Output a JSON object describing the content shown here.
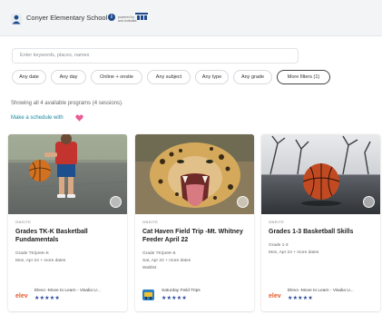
{
  "header": {
    "school_name": "Conyer Elementary School",
    "info_icon": "i",
    "powered_line1": "powered by",
    "powered_line2": "and durkdata"
  },
  "search": {
    "placeholder": "Enter keywords, places, names"
  },
  "filters": [
    {
      "label": "Any date",
      "active": false
    },
    {
      "label": "Any day",
      "active": false
    },
    {
      "label": "Online + onsite",
      "active": false
    },
    {
      "label": "Any subject",
      "active": false
    },
    {
      "label": "Any type",
      "active": false
    },
    {
      "label": "Any grade",
      "active": false
    },
    {
      "label": "More filters (1)",
      "active": true
    }
  ],
  "results": {
    "summary": "Showing all 4 available programs (4 sessions).",
    "make_schedule": "Make a schedule with"
  },
  "cards": [
    {
      "category": "ONSITE",
      "title": "Grades TK-K Basketball Fundamentals",
      "meta": [
        "Grade TK/preK-K",
        "Mon, Apr 24 + more dates"
      ],
      "provider": "Elevo -Move to Learn - Visalia U...",
      "stars": "★★★★★",
      "logo": "elevo"
    },
    {
      "category": "ONSITE",
      "title": "Cat Haven Field Trip -Mt. Whitney Feeder April 22",
      "meta": [
        "Grade TK/preK-6",
        "Sat, Apr 22 + more dates",
        "Waitlist"
      ],
      "provider": "Saturday Field Trips",
      "stars": "★★★★★",
      "logo": "field-trips"
    },
    {
      "category": "ONSITE",
      "title": "Grades 1-3 Basketball Skills",
      "meta": [
        "Grade 1-3",
        "Mon, Apr 24 + more dates"
      ],
      "provider": "Elevo -Move to Learn - Visalia U...",
      "stars": "★★★★★",
      "logo": "elevo"
    }
  ],
  "colors": {
    "brand_blue": "#1e4a8c",
    "link_teal": "#1a8aa0",
    "heart_pink": "#e85d95",
    "star_blue": "#27439a",
    "elevo_orange": "#e6592b"
  }
}
